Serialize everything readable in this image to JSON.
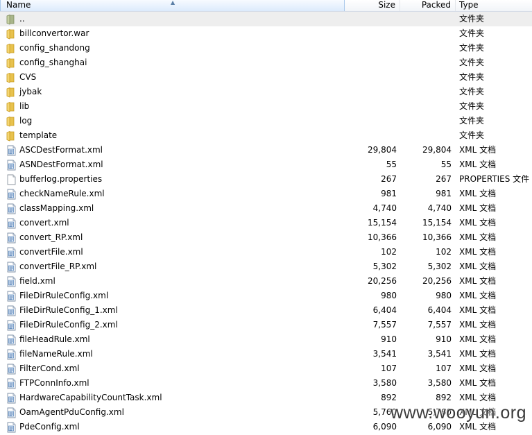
{
  "header": {
    "name": "Name",
    "size": "Size",
    "packed": "Packed",
    "type": "Type"
  },
  "rows": [
    {
      "name": "..",
      "size": "",
      "packed": "",
      "type": "文件夹",
      "icon": "parent-folder-icon"
    },
    {
      "name": "billconvertor.war",
      "size": "",
      "packed": "",
      "type": "文件夹",
      "icon": "folder-icon"
    },
    {
      "name": "config_shandong",
      "size": "",
      "packed": "",
      "type": "文件夹",
      "icon": "folder-icon"
    },
    {
      "name": "config_shanghai",
      "size": "",
      "packed": "",
      "type": "文件夹",
      "icon": "folder-icon"
    },
    {
      "name": "CVS",
      "size": "",
      "packed": "",
      "type": "文件夹",
      "icon": "folder-icon"
    },
    {
      "name": "jybak",
      "size": "",
      "packed": "",
      "type": "文件夹",
      "icon": "folder-icon"
    },
    {
      "name": "lib",
      "size": "",
      "packed": "",
      "type": "文件夹",
      "icon": "folder-icon"
    },
    {
      "name": "log",
      "size": "",
      "packed": "",
      "type": "文件夹",
      "icon": "folder-icon"
    },
    {
      "name": "template",
      "size": "",
      "packed": "",
      "type": "文件夹",
      "icon": "folder-icon"
    },
    {
      "name": "ASCDestFormat.xml",
      "size": "29,804",
      "packed": "29,804",
      "type": "XML 文档",
      "icon": "xml-file-icon"
    },
    {
      "name": "ASNDestFormat.xml",
      "size": "55",
      "packed": "55",
      "type": "XML 文档",
      "icon": "xml-file-icon"
    },
    {
      "name": "bufferlog.properties",
      "size": "267",
      "packed": "267",
      "type": "PROPERTIES 文件",
      "icon": "file-icon"
    },
    {
      "name": "checkNameRule.xml",
      "size": "981",
      "packed": "981",
      "type": "XML 文档",
      "icon": "xml-file-icon"
    },
    {
      "name": "classMapping.xml",
      "size": "4,740",
      "packed": "4,740",
      "type": "XML 文档",
      "icon": "xml-file-icon"
    },
    {
      "name": "convert.xml",
      "size": "15,154",
      "packed": "15,154",
      "type": "XML 文档",
      "icon": "xml-file-icon"
    },
    {
      "name": "convert_RP.xml",
      "size": "10,366",
      "packed": "10,366",
      "type": "XML 文档",
      "icon": "xml-file-icon"
    },
    {
      "name": "convertFile.xml",
      "size": "102",
      "packed": "102",
      "type": "XML 文档",
      "icon": "xml-file-icon"
    },
    {
      "name": "convertFile_RP.xml",
      "size": "5,302",
      "packed": "5,302",
      "type": "XML 文档",
      "icon": "xml-file-icon"
    },
    {
      "name": "field.xml",
      "size": "20,256",
      "packed": "20,256",
      "type": "XML 文档",
      "icon": "xml-file-icon"
    },
    {
      "name": "FileDirRuleConfig.xml",
      "size": "980",
      "packed": "980",
      "type": "XML 文档",
      "icon": "xml-file-icon"
    },
    {
      "name": "FileDirRuleConfig_1.xml",
      "size": "6,404",
      "packed": "6,404",
      "type": "XML 文档",
      "icon": "xml-file-icon"
    },
    {
      "name": "FileDirRuleConfig_2.xml",
      "size": "7,557",
      "packed": "7,557",
      "type": "XML 文档",
      "icon": "xml-file-icon"
    },
    {
      "name": "fileHeadRule.xml",
      "size": "910",
      "packed": "910",
      "type": "XML 文档",
      "icon": "xml-file-icon"
    },
    {
      "name": "fileNameRule.xml",
      "size": "3,541",
      "packed": "3,541",
      "type": "XML 文档",
      "icon": "xml-file-icon"
    },
    {
      "name": "FilterCond.xml",
      "size": "107",
      "packed": "107",
      "type": "XML 文档",
      "icon": "xml-file-icon"
    },
    {
      "name": "FTPConnInfo.xml",
      "size": "3,580",
      "packed": "3,580",
      "type": "XML 文档",
      "icon": "xml-file-icon"
    },
    {
      "name": "HardwareCapabilityCountTask.xml",
      "size": "892",
      "packed": "892",
      "type": "XML 文档",
      "icon": "xml-file-icon"
    },
    {
      "name": "OamAgentPduConfig.xml",
      "size": "5,760",
      "packed": "5,760",
      "type": "XML 文档",
      "icon": "xml-file-icon"
    },
    {
      "name": "PdeConfig.xml",
      "size": "6,090",
      "packed": "6,090",
      "type": "XML 文档",
      "icon": "xml-file-icon"
    }
  ],
  "watermark": "www.wooyun.org"
}
